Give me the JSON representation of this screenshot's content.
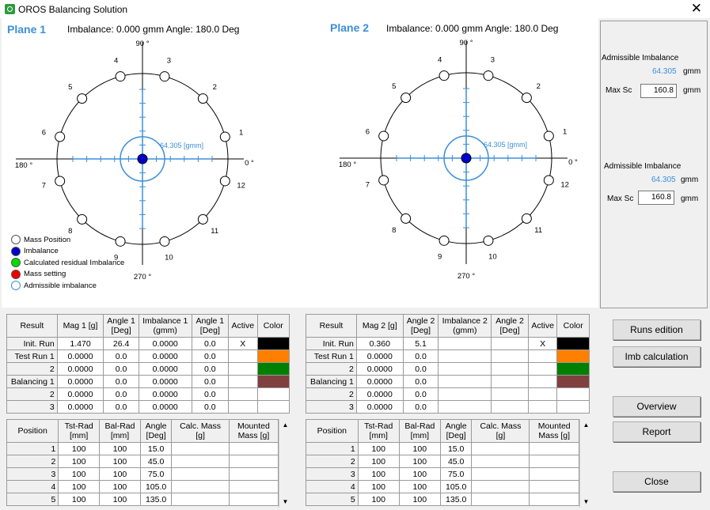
{
  "window": {
    "title": "OROS Balancing Solution",
    "close": "✕"
  },
  "plane1": {
    "title": "Plane 1",
    "imbalance_text": "Imbalance: 0.000 gmm Angle: 180.0 Deg",
    "circle_label": "64.305 [gmm]",
    "angle_labels": {
      "top": "90 °",
      "bottom": "270 °",
      "left": "180 °",
      "right": "0 °"
    },
    "positions": [
      "1",
      "2",
      "3",
      "4",
      "5",
      "6",
      "7",
      "8",
      "9",
      "10",
      "11",
      "12"
    ]
  },
  "plane2": {
    "title": "Plane 2",
    "imbalance_text": "Imbalance: 0.000 gmm Angle: 180.0 Deg",
    "circle_label": "64.305 [gmm]",
    "angle_labels": {
      "top": "90 °",
      "bottom": "270 °",
      "left": "180 °",
      "right": "0 °"
    },
    "positions": [
      "1",
      "2",
      "3",
      "4",
      "5",
      "6",
      "7",
      "8",
      "9",
      "10",
      "11",
      "12"
    ]
  },
  "legend": [
    {
      "label": "Mass Position",
      "color": "#ffffff"
    },
    {
      "label": "Imbalance",
      "color": "#0000cc"
    },
    {
      "label": "Calculated residual Imbalance",
      "color": "#00dd00"
    },
    {
      "label": "Mass setting",
      "color": "#ee0000"
    },
    {
      "label": "Admissible imbalance",
      "color": "#ffffff"
    }
  ],
  "side": {
    "p1": {
      "label": "Admissible Imbalance",
      "value": "64.305",
      "unit": "gmm",
      "max_label": "Max Sc",
      "max_value": "160.8",
      "max_unit": "gmm"
    },
    "p2": {
      "label": "Admissible Imbalance",
      "value": "64.305",
      "unit": "gmm",
      "max_label": "Max Sc",
      "max_value": "160.8",
      "max_unit": "gmm"
    }
  },
  "result1": {
    "headers": [
      "Result",
      "Mag 1 [g]",
      "Angle 1 [Deg]",
      "Imbalance 1 (gmm)",
      "Angle 1 [Deg]",
      "Active",
      "Color"
    ],
    "rows": [
      {
        "label": "Init. Run",
        "c1": "1.470",
        "c2": "26.4",
        "c3": "0.0000",
        "c4": "0.0",
        "active": "X",
        "color": "#000000"
      },
      {
        "label": "Test Run 1",
        "c1": "0.0000",
        "c2": "0.0",
        "c3": "0.0000",
        "c4": "0.0",
        "active": "",
        "color": "#ff8000"
      },
      {
        "label": "2",
        "c1": "0.0000",
        "c2": "0.0",
        "c3": "0.0000",
        "c4": "0.0",
        "active": "",
        "color": "#008000"
      },
      {
        "label": "Balancing 1",
        "c1": "0.0000",
        "c2": "0.0",
        "c3": "0.0000",
        "c4": "0.0",
        "active": "",
        "color": "#804040"
      },
      {
        "label": "2",
        "c1": "0.0000",
        "c2": "0.0",
        "c3": "0.0000",
        "c4": "0.0",
        "active": "",
        "color": ""
      },
      {
        "label": "3",
        "c1": "0.0000",
        "c2": "0.0",
        "c3": "0.0000",
        "c4": "0.0",
        "active": "",
        "color": ""
      }
    ]
  },
  "result2": {
    "headers": [
      "Result",
      "Mag 2 [g]",
      "Angle 2 [Deg]",
      "Imbalance 2 (gmm)",
      "Angle 2 [Deg]",
      "Active",
      "Color"
    ],
    "rows": [
      {
        "label": "Init. Run",
        "c1": "0.360",
        "c2": "5.1",
        "c3": "",
        "c4": "",
        "active": "X",
        "color": "#000000"
      },
      {
        "label": "Test Run 1",
        "c1": "0.0000",
        "c2": "0.0",
        "c3": "",
        "c4": "",
        "active": "",
        "color": "#ff8000"
      },
      {
        "label": "2",
        "c1": "0.0000",
        "c2": "0.0",
        "c3": "",
        "c4": "",
        "active": "",
        "color": "#008000"
      },
      {
        "label": "Balancing 1",
        "c1": "0.0000",
        "c2": "0.0",
        "c3": "",
        "c4": "",
        "active": "",
        "color": "#804040"
      },
      {
        "label": "2",
        "c1": "0.0000",
        "c2": "0.0",
        "c3": "",
        "c4": "",
        "active": "",
        "color": ""
      },
      {
        "label": "3",
        "c1": "0.0000",
        "c2": "0.0",
        "c3": "",
        "c4": "",
        "active": "",
        "color": ""
      }
    ]
  },
  "pos1": {
    "headers": [
      "Position",
      "Tst-Rad [mm]",
      "Bal-Rad [mm]",
      "Angle [Deg]",
      "Calc. Mass [g]",
      "Mounted Mass [g]"
    ],
    "rows": [
      {
        "pos": "1",
        "tst": "100",
        "bal": "100",
        "ang": "15.0"
      },
      {
        "pos": "2",
        "tst": "100",
        "bal": "100",
        "ang": "45.0"
      },
      {
        "pos": "3",
        "tst": "100",
        "bal": "100",
        "ang": "75.0"
      },
      {
        "pos": "4",
        "tst": "100",
        "bal": "100",
        "ang": "105.0"
      },
      {
        "pos": "5",
        "tst": "100",
        "bal": "100",
        "ang": "135.0"
      }
    ]
  },
  "pos2": {
    "headers": [
      "Position",
      "Tst-Rad [mm]",
      "Bal-Rad [mm]",
      "Angle [Deg]",
      "Calc. Mass [g]",
      "Mounted Mass [g]"
    ],
    "rows": [
      {
        "pos": "1",
        "tst": "100",
        "bal": "100",
        "ang": "15.0"
      },
      {
        "pos": "2",
        "tst": "100",
        "bal": "100",
        "ang": "45.0"
      },
      {
        "pos": "3",
        "tst": "100",
        "bal": "100",
        "ang": "75.0"
      },
      {
        "pos": "4",
        "tst": "100",
        "bal": "100",
        "ang": "105.0"
      },
      {
        "pos": "5",
        "tst": "100",
        "bal": "100",
        "ang": "135.0"
      }
    ]
  },
  "buttons": {
    "runs": "Runs edition",
    "imb": "Imb calculation",
    "overview": "Overview",
    "report": "Report",
    "close": "Close"
  }
}
